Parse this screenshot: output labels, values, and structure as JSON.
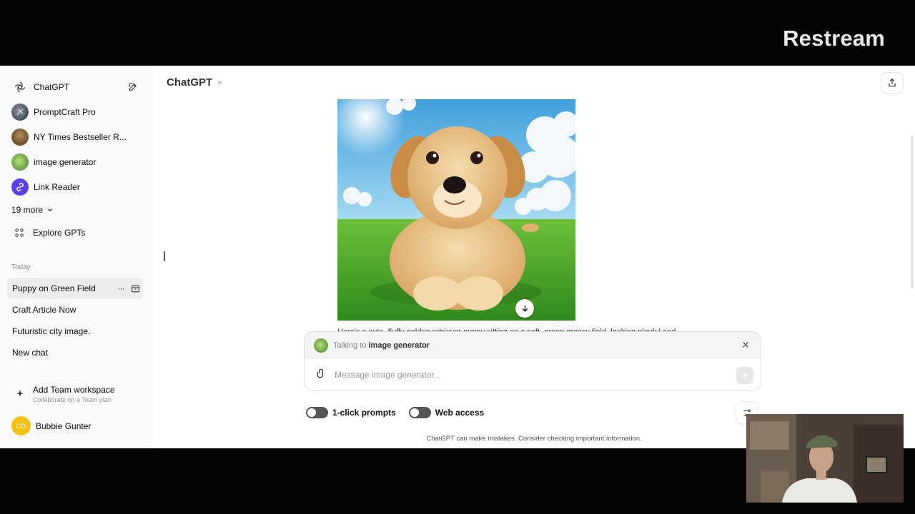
{
  "overlay": {
    "logo_text": "Restream"
  },
  "sidebar": {
    "gpts": [
      {
        "label": "ChatGPT",
        "icon": "openai-logo-icon"
      },
      {
        "label": "PromptCraft Pro",
        "icon": "promptcraft-avatar"
      },
      {
        "label": "NY Times Bestseller R...",
        "icon": "nytimes-avatar"
      },
      {
        "label": "image generator",
        "icon": "image-generator-avatar"
      },
      {
        "label": "Link Reader",
        "icon": "link-reader-avatar"
      }
    ],
    "more_label": "19 more",
    "explore_label": "Explore GPTs",
    "section_today": "Today",
    "chats": [
      {
        "label": "Puppy on Green Field",
        "active": true
      },
      {
        "label": "Craft Article Now",
        "active": false
      },
      {
        "label": "Futuristic city image.",
        "active": false
      },
      {
        "label": "New chat",
        "active": false
      }
    ],
    "chat_more": "···",
    "team": {
      "title": "Add Team workspace",
      "subtitle": "Collaborate on a Team plan"
    },
    "user": {
      "initials": "CO",
      "name": "Bubbie Gunter"
    }
  },
  "main": {
    "model_name": "ChatGPT",
    "response_text": "Here's a cute, fluffy golden retriever puppy sitting on a soft, green grassy field, looking playful and",
    "composer": {
      "talking_prefix": "Talking to",
      "talking_to": "image generator",
      "placeholder": "Message image generator..."
    },
    "toggles": [
      {
        "label": "1-click prompts",
        "on": false
      },
      {
        "label": "Web access",
        "on": false
      }
    ],
    "disclaimer": "ChatGPT can make mistakes. Consider checking important information."
  },
  "colors": {
    "accent_yellow": "#f2c316",
    "active_chat_bg": "#ececec",
    "sidebar_bg": "#f9f9f9"
  }
}
